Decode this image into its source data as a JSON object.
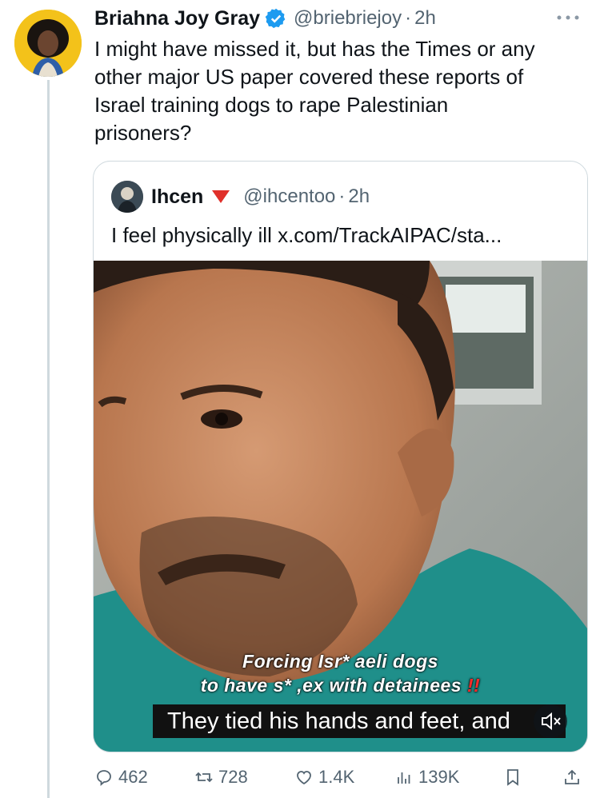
{
  "tweet": {
    "author_name": "Briahna Joy Gray",
    "handle": "@briebriejoy",
    "separator": "·",
    "time": "2h",
    "text": "I might have missed it, but has the Times or any\nother major US paper covered these reports of\nIsrael training dogs to rape Palestinian\nprisoners?"
  },
  "quoted_tweet": {
    "author_name": "Ihcen",
    "handle": "@ihcentoo",
    "separator": "·",
    "time": "2h",
    "text": "I feel physically ill x.com/TrackAIPAC/sta...",
    "video_overlay_line1": "Forcing Isr* aeli dogs",
    "video_overlay_line2": "to have s* ,ex with detainees",
    "video_overlay_marks": "!!",
    "video_caption": "They tied his hands and feet, and"
  },
  "actions": {
    "replies": "462",
    "reposts": "728",
    "likes": "1.4K",
    "views": "139K"
  },
  "icons": [
    "verified-badge-icon",
    "more-icon",
    "red-triangle-icon",
    "volume-muted-icon",
    "reply-icon",
    "repost-icon",
    "like-icon",
    "views-icon",
    "bookmark-icon",
    "share-icon"
  ],
  "colors": {
    "verified": "#1d9bf0",
    "secondary_text": "#536471",
    "border": "#cfd9de"
  }
}
